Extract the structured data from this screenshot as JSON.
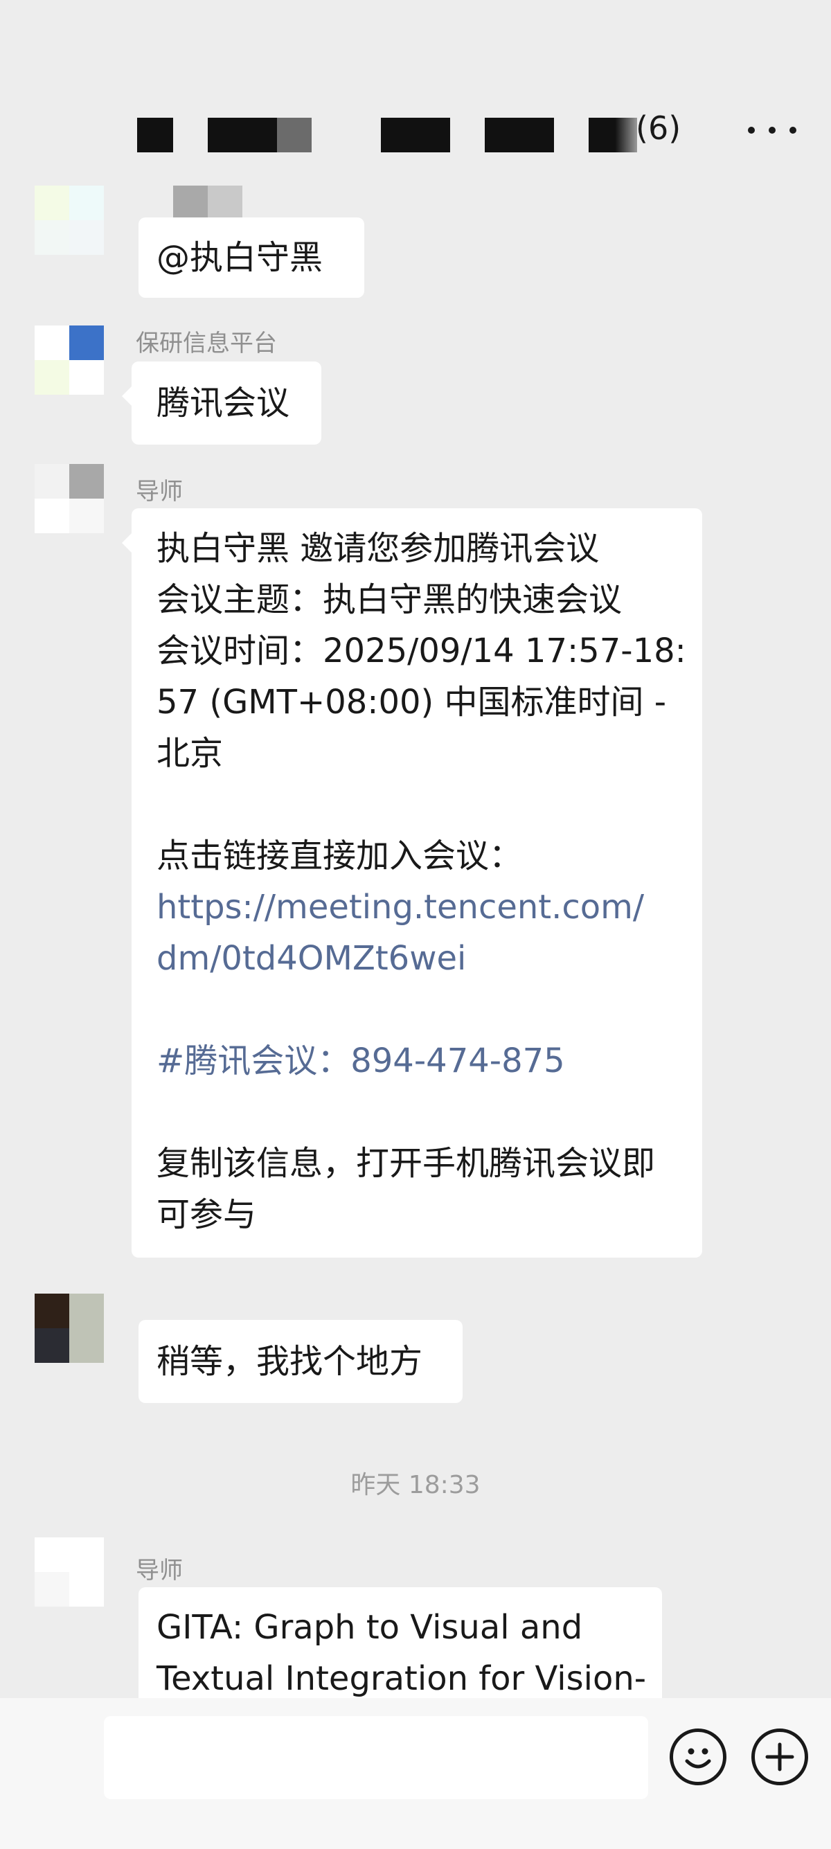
{
  "header": {
    "member_count": "(6)",
    "more_label": "···"
  },
  "messages": [
    {
      "sender": "",
      "lines": [
        "@执白守黑"
      ]
    },
    {
      "sender": "保研信息平台",
      "lines": [
        "腾讯会议"
      ]
    },
    {
      "sender": "导师",
      "lines": [
        "执白守黑 邀请您参加腾讯会议",
        "会议主题：执白守黑的快速会议",
        "会议时间：2025/09/14 17:57-18:",
        "57 (GMT+08:00) 中国标准时间 -",
        "北京",
        "",
        "点击链接直接加入会议：",
        "https://meeting.tencent.com/",
        "dm/0td4OMZt6wei",
        "",
        "#腾讯会议：894-474-875",
        "",
        "复制该信息，打开手机腾讯会议即",
        "可参与"
      ]
    },
    {
      "sender": "",
      "lines": [
        "稍等，我找个地方"
      ]
    },
    {
      "sender": "导师",
      "lines": [
        "GITA: Graph to Visual and",
        "Textual Integration for Vision-"
      ]
    }
  ],
  "timestamp": "昨天 18:33",
  "input": {
    "placeholder": ""
  },
  "colors": {
    "background": "#ededed",
    "bubble": "#ffffff",
    "link": "#566b94",
    "sender": "#8f8f8f"
  }
}
